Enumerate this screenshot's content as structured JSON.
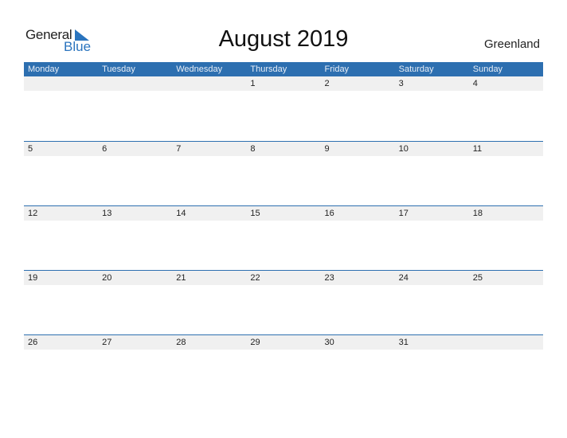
{
  "logo": {
    "text_general": "General",
    "text_blue": "Blue",
    "icon": "triangle-flag-icon"
  },
  "title": "August 2019",
  "country": "Greenland",
  "colors": {
    "accent": "#2d6fb0",
    "row_bg": "#f0f0f0"
  },
  "weekdays": [
    "Monday",
    "Tuesday",
    "Wednesday",
    "Thursday",
    "Friday",
    "Saturday",
    "Sunday"
  ],
  "weeks": [
    [
      "",
      "",
      "",
      "1",
      "2",
      "3",
      "4"
    ],
    [
      "5",
      "6",
      "7",
      "8",
      "9",
      "10",
      "11"
    ],
    [
      "12",
      "13",
      "14",
      "15",
      "16",
      "17",
      "18"
    ],
    [
      "19",
      "20",
      "21",
      "22",
      "23",
      "24",
      "25"
    ],
    [
      "26",
      "27",
      "28",
      "29",
      "30",
      "31",
      ""
    ]
  ]
}
